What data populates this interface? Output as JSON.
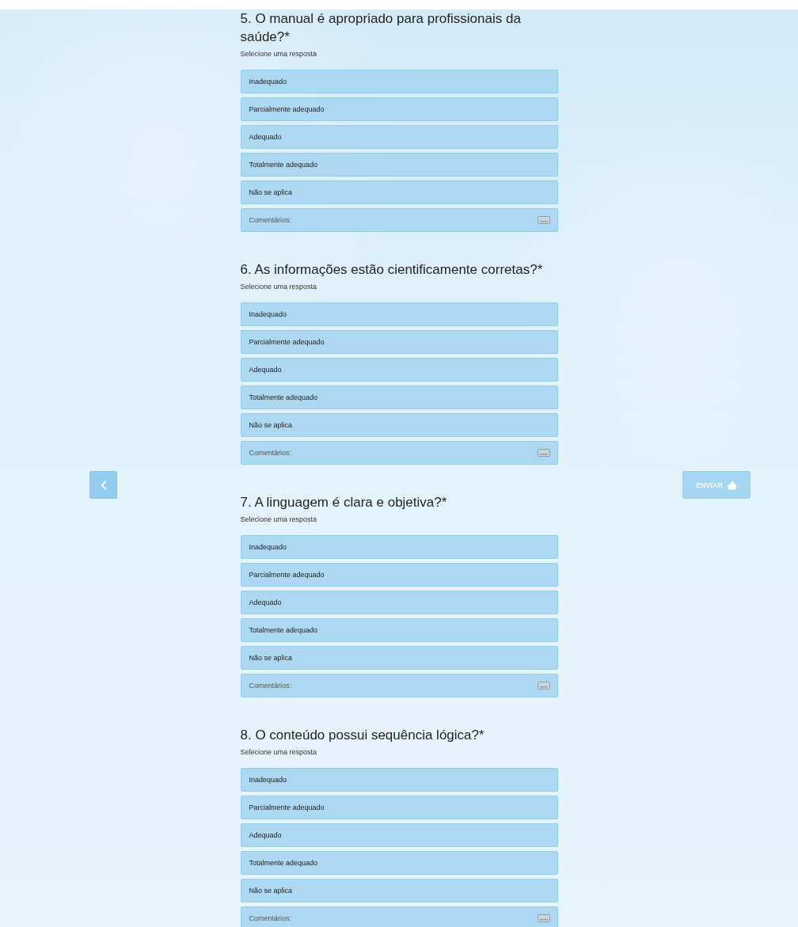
{
  "questions": [
    {
      "title": "5. O manual é apropriado para profissionais da saúde?*",
      "hint": "Selecione uma resposta",
      "options": [
        {
          "label": "Inadequado",
          "selected": false
        },
        {
          "label": "Parcialmente adequado",
          "selected": false
        },
        {
          "label": "Adequado",
          "selected": false
        },
        {
          "label": "Totalmente adequado",
          "selected": false
        },
        {
          "label": "Não se aplica",
          "selected": false
        }
      ],
      "comment": {
        "placeholder": "Comentários:"
      }
    },
    {
      "title": "6. As informações estão cientificamente corretas?*",
      "hint": "Selecione uma resposta",
      "options": [
        {
          "label": "Inadequado",
          "selected": false
        },
        {
          "label": "Parcialmente adequado",
          "selected": false
        },
        {
          "label": "Adequado",
          "selected": false
        },
        {
          "label": "Totalmente adequado",
          "selected": false
        },
        {
          "label": "Não se aplica",
          "selected": false
        }
      ],
      "comment": {
        "placeholder": "Comentários:"
      }
    },
    {
      "title": "7. A linguagem é clara e objetiva?*",
      "hint": "Selecione uma resposta",
      "options": [
        {
          "label": "Inadequado",
          "selected": false
        },
        {
          "label": "Parcialmente adequado",
          "selected": false
        },
        {
          "label": "Adequado",
          "selected": false
        },
        {
          "label": "Totalmente adequado",
          "selected": false
        },
        {
          "label": "Não se aplica",
          "selected": false
        }
      ],
      "comment": {
        "placeholder": "Comentários:"
      }
    },
    {
      "title": "8. O conteúdo possui sequência lógica?*",
      "hint": "Selecione uma resposta",
      "options": [
        {
          "label": "Inadequado",
          "selected": false
        },
        {
          "label": "Parcialmente adequado",
          "selected": false
        },
        {
          "label": "Adequado",
          "selected": false
        },
        {
          "label": "Totalmente adequado",
          "selected": false
        },
        {
          "label": "Não se aplica",
          "selected": false
        }
      ],
      "comment": {
        "placeholder": "Comentários:"
      }
    }
  ],
  "nav": {
    "submit": "ENVIAR"
  }
}
